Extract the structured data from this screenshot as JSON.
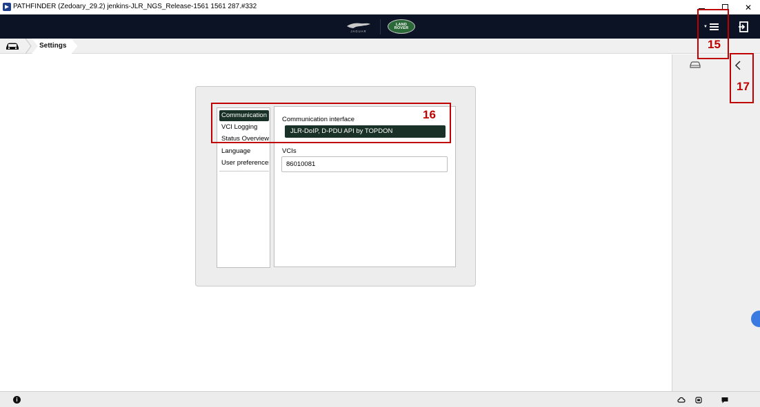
{
  "window": {
    "title": "PATHFINDER (Zedoary_29.2) jenkins-JLR_NGS_Release-1561 1561 287.#332",
    "close_glyph": "✕"
  },
  "header": {
    "jaguar_logo_text": "JAGUAR",
    "landrover_logo_text": [
      "LAND",
      "ROVER"
    ]
  },
  "breadcrumb": {
    "current": "Settings"
  },
  "settings": {
    "nav_items": [
      {
        "label": "Communication",
        "active": true
      },
      {
        "label": "VCI Logging",
        "active": false
      },
      {
        "label": "Status Overview",
        "active": false
      },
      {
        "label": "Language",
        "active": false
      },
      {
        "label": "User preferences",
        "active": false
      }
    ],
    "communication_interface_label": "Communication interface",
    "communication_interface_value": "JLR-DoIP, D-PDU API by TOPDON",
    "vcis_label": "VCIs",
    "vcis_value": "86010081"
  },
  "annotations": {
    "label_15": "15",
    "label_16": "16",
    "label_17": "17"
  },
  "statusbar": {
    "info_glyph": "i"
  },
  "colors": {
    "header_bg": "#0b1325",
    "accent_dark_green": "#1a3128",
    "annotation_red": "#c00000",
    "landrover_green": "#2b6a38"
  }
}
